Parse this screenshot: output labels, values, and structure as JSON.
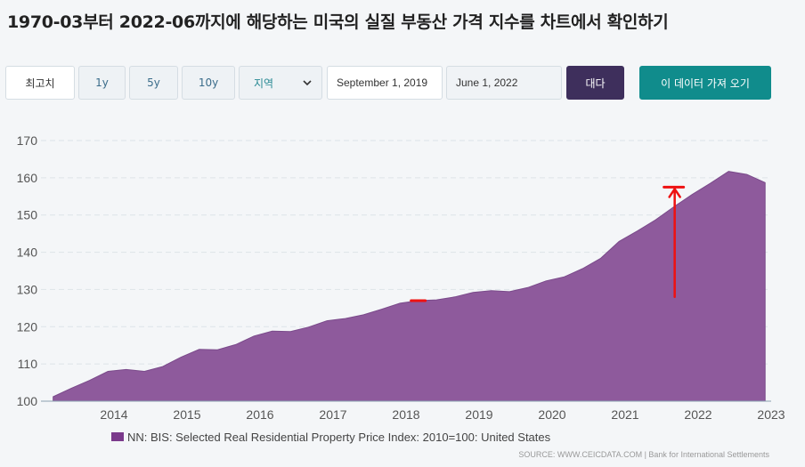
{
  "page": {
    "title": "1970-03부터 2022-06까지에 해당하는 미국의 실질 부동산 가격 지수를 차트에서 확인하기",
    "source": "SOURCE: WWW.CEICDATA.COM | Bank for International Settlements"
  },
  "toolbar": {
    "max_label": "최고치",
    "r1y_label": "1y",
    "r5y_label": "5y",
    "r10y_label": "10y",
    "region_label": "지역",
    "start_date": "September 1, 2019",
    "end_date": "June 1, 2022",
    "compare_label": "대다",
    "get_data_label": "이 데이터 가져 오기"
  },
  "colors": {
    "area_fill": "#8e5a9c",
    "legend_swatch": "#7b3a8c",
    "annotation": "#ee1111",
    "compare_button": "#3e2f5c",
    "get_data_button": "#108c8c"
  },
  "chart_data": {
    "type": "area",
    "title": "",
    "xlabel": "",
    "ylabel": "",
    "ylim": [
      100,
      170
    ],
    "yticks": [
      100,
      110,
      120,
      130,
      140,
      150,
      160,
      170
    ],
    "xlim": [
      2013.0,
      2023.0
    ],
    "xticks": [
      "2014",
      "2015",
      "2016",
      "2017",
      "2018",
      "2019",
      "2020",
      "2021",
      "2022",
      "2023"
    ],
    "grid": "horizontal dashed",
    "legend_position": "bottom-center",
    "series": [
      {
        "name": "NN: BIS: Selected Real Residential Property Price Index: 2010=100: United States",
        "x": [
          "2013-03",
          "2013-06",
          "2013-09",
          "2013-12",
          "2014-03",
          "2014-06",
          "2014-09",
          "2014-12",
          "2015-03",
          "2015-06",
          "2015-09",
          "2015-12",
          "2016-03",
          "2016-06",
          "2016-09",
          "2016-12",
          "2017-03",
          "2017-06",
          "2017-09",
          "2017-12",
          "2018-03",
          "2018-06",
          "2018-09",
          "2018-12",
          "2019-03",
          "2019-06",
          "2019-09",
          "2019-12",
          "2020-03",
          "2020-06",
          "2020-09",
          "2020-12",
          "2021-03",
          "2021-06",
          "2021-09",
          "2021-12",
          "2022-03",
          "2022-06",
          "2022-09",
          "2022-12"
        ],
        "values": [
          101.2,
          103.5,
          105.6,
          108.0,
          108.5,
          108.0,
          109.3,
          111.8,
          113.9,
          113.8,
          115.2,
          117.5,
          118.8,
          118.7,
          119.9,
          121.6,
          122.2,
          123.2,
          124.7,
          126.3,
          127.0,
          127.2,
          128.0,
          129.2,
          129.7,
          129.4,
          130.5,
          132.3,
          133.4,
          135.6,
          138.4,
          142.9,
          145.7,
          148.7,
          152.2,
          155.5,
          158.5,
          161.7,
          160.9,
          158.7
        ]
      }
    ],
    "annotations": [
      {
        "type": "dash",
        "x": "2018-03",
        "y": 127.0
      },
      {
        "type": "dash",
        "x": "2021-09",
        "y": 157.5
      },
      {
        "type": "arrow",
        "x": "2021-09",
        "y_from": 128.0,
        "y_to": 157.0
      }
    ]
  }
}
